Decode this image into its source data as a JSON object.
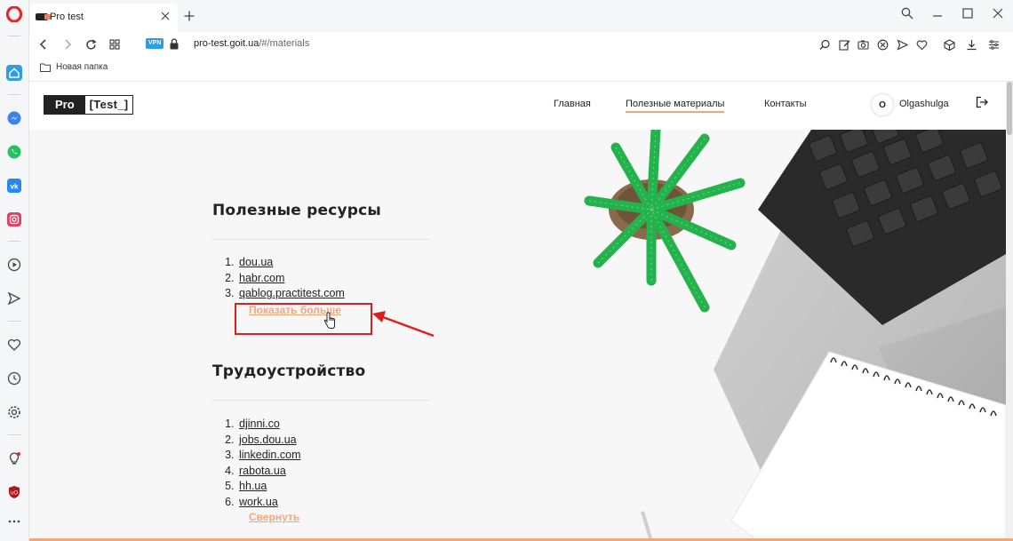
{
  "browser": {
    "tab": {
      "title": "Pro test"
    },
    "address": {
      "url_host": "pro-test.goit.ua",
      "url_path": "/#/materials",
      "vpn_label": "VPN"
    },
    "bookmarks": [
      {
        "label": "Новая папка"
      }
    ],
    "accent_color": "#e8262c"
  },
  "site": {
    "logo": {
      "pro": "Pro",
      "test": "[Test_]"
    },
    "nav": [
      {
        "label": "Главная",
        "active": false
      },
      {
        "label": "Полезные материалы",
        "active": true
      },
      {
        "label": "Контакты",
        "active": false
      }
    ],
    "user": {
      "initial": "O",
      "name": "Olgashulga"
    },
    "accent_color": "#f3a57b"
  },
  "sections": [
    {
      "title": "Полезные ресурсы",
      "links": [
        "dou.ua",
        "habr.com",
        "qablog.practitest.com"
      ],
      "toggle_label": "Показать больше"
    },
    {
      "title": "Трудоустройство",
      "links": [
        "djinni.co",
        "jobs.dou.ua",
        "linkedin.com",
        "rabota.ua",
        "hh.ua",
        "work.ua"
      ],
      "toggle_label": "Свернуть"
    }
  ]
}
